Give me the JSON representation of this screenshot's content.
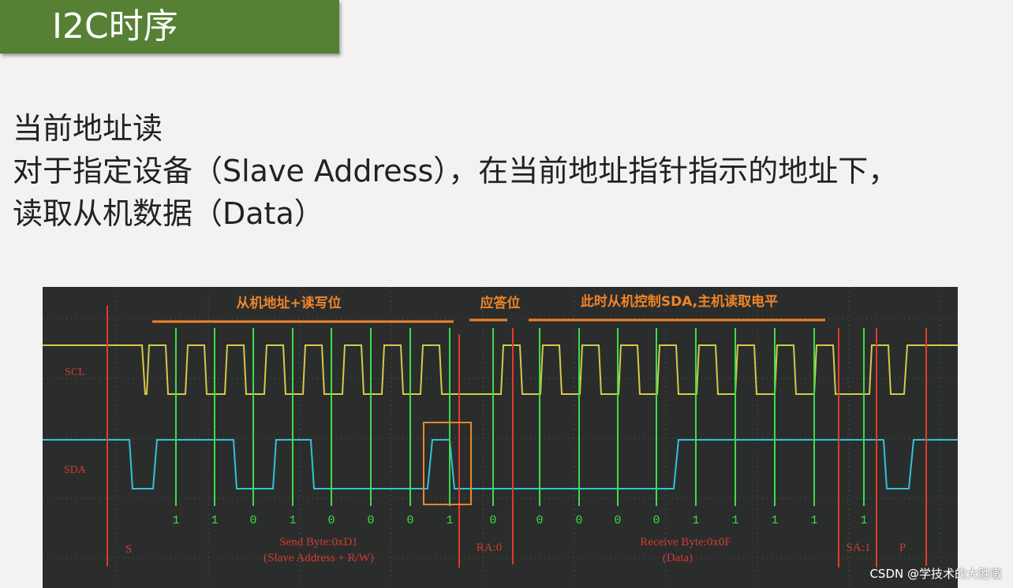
{
  "slide": {
    "title": "I2C时序",
    "description_lines": [
      "当前地址读",
      "对于指定设备（Slave Address），在当前地址指针指示的地址下，",
      "读取从机数据（Data）"
    ],
    "watermark": "CSDN @学技术的大胜嗷"
  },
  "scope": {
    "channel_labels": {
      "scl": "SCL",
      "sda": "SDA"
    },
    "annotations": {
      "address_rw": "从机地址+读写位",
      "ack": "应答位",
      "slave_controls": "此时从机控制SDA,主机读取电平"
    },
    "bits": [
      "1",
      "1",
      "0",
      "1",
      "0",
      "0",
      "0",
      "1",
      "0",
      "0",
      "0",
      "0",
      "0",
      "1",
      "1",
      "1",
      "1",
      "1"
    ],
    "decode": {
      "start": "S",
      "send_byte": "Send Byte:0xD1",
      "send_detail": "(Slave Address + R/W)",
      "ra": "RA:0",
      "receive_byte": "Receive Byte:0x0F",
      "receive_detail": "(Data)",
      "sa": "SA:1",
      "stop": "P"
    },
    "colors": {
      "scl": "#d7c84a",
      "sda": "#34c2d6",
      "sample_line": "#3ddc4a",
      "marker_line": "#e23a2a",
      "annotation": "#f0842a",
      "decode_text": "#d23b2e"
    }
  }
}
